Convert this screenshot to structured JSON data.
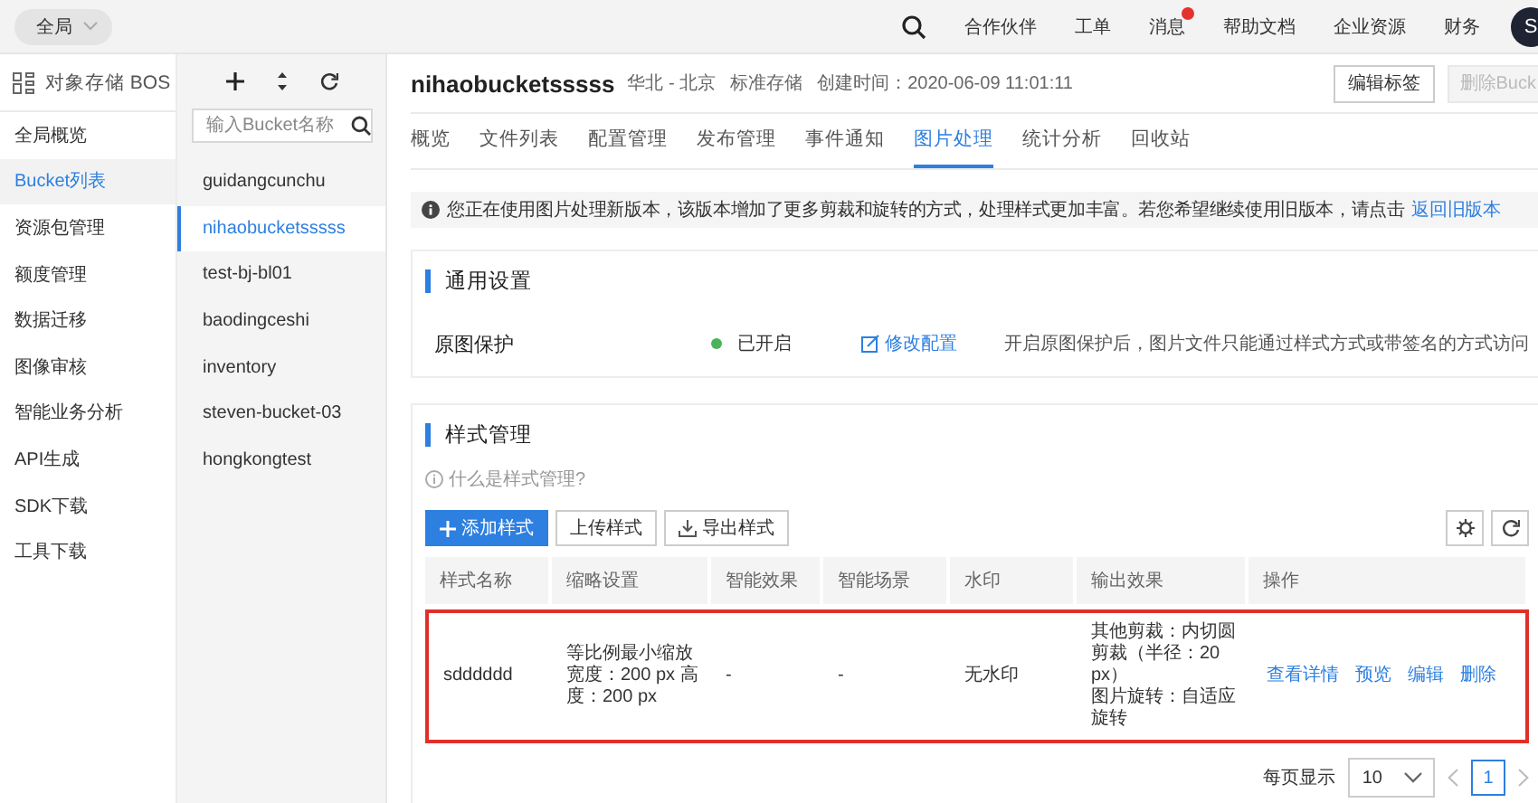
{
  "top_bar": {
    "scope": "全局",
    "links": [
      {
        "label": "合作伙伴",
        "dot": false
      },
      {
        "label": "工单",
        "dot": false
      },
      {
        "label": "消息",
        "dot": true
      },
      {
        "label": "帮助文档",
        "dot": false
      },
      {
        "label": "企业资源",
        "dot": false
      },
      {
        "label": "财务",
        "dot": false
      }
    ],
    "avatar": "S"
  },
  "sidebar": {
    "title": "对象存储 BOS",
    "items": [
      {
        "label": "全局概览",
        "selected": false
      },
      {
        "label": "Bucket列表",
        "selected": true
      },
      {
        "label": "资源包管理",
        "selected": false
      },
      {
        "label": "额度管理",
        "selected": false
      },
      {
        "label": "数据迁移",
        "selected": false
      },
      {
        "label": "图像审核",
        "selected": false
      },
      {
        "label": "智能业务分析",
        "selected": false
      },
      {
        "label": "API生成",
        "selected": false
      },
      {
        "label": "SDK下载",
        "selected": false
      },
      {
        "label": "工具下载",
        "selected": false
      }
    ]
  },
  "bucket_list": {
    "search": {
      "placeholder": "输入Bucket名称"
    },
    "items": [
      {
        "label": "guidangcunchu",
        "selected": false
      },
      {
        "label": "nihaobucketsssss",
        "selected": true
      },
      {
        "label": "test-bj-bl01",
        "selected": false
      },
      {
        "label": "baodingceshi",
        "selected": false
      },
      {
        "label": "inventory",
        "selected": false
      },
      {
        "label": "steven-bucket-03",
        "selected": false
      },
      {
        "label": "hongkongtest",
        "selected": false
      }
    ]
  },
  "header": {
    "title": "nihaobucketsssss",
    "region": "华北 - 北京",
    "storage_class": "标准存储",
    "created": "创建时间：2020-06-09 11:01:11",
    "buttons": [
      {
        "label": "编辑标签",
        "disabled": false
      },
      {
        "label": "删除Buck",
        "disabled": true
      }
    ]
  },
  "tabs": [
    {
      "label": "概览",
      "selected": false
    },
    {
      "label": "文件列表",
      "selected": false
    },
    {
      "label": "配置管理",
      "selected": false
    },
    {
      "label": "发布管理",
      "selected": false
    },
    {
      "label": "事件通知",
      "selected": false
    },
    {
      "label": "图片处理",
      "selected": true
    },
    {
      "label": "统计分析",
      "selected": false
    },
    {
      "label": "回收站",
      "selected": false
    }
  ],
  "notice": {
    "text": "您正在使用图片处理新版本，该版本增加了更多剪裁和旋转的方式，处理样式更加丰富。若您希望继续使用旧版本，请点击",
    "link": "返回旧版本"
  },
  "general_settings": {
    "title": "通用设置",
    "rows": [
      {
        "label": "原图保护",
        "on": true,
        "status": "已开启",
        "action": "修改配置",
        "description": "开启原图保护后，图片文件只能通过样式方式或带签名的方式访问"
      }
    ]
  },
  "style_management": {
    "title": "样式管理",
    "help": "什么是样式管理?",
    "buttons": [
      {
        "label": "添加样式",
        "kind": "primary"
      },
      {
        "label": "上传样式",
        "kind": "default"
      },
      {
        "label": "导出样式",
        "kind": "export"
      }
    ],
    "table": {
      "columns": [
        "样式名称",
        "缩略设置",
        "智能效果",
        "智能场景",
        "水印",
        "输出效果",
        "操作"
      ],
      "rows": [
        {
          "highlighted": true,
          "name": "sdddddd",
          "thumbnail": [
            "等比例最小缩放",
            "宽度：200 px 高度：200 px"
          ],
          "smart_effect": "-",
          "smart_scene": "-",
          "watermark": "无水印",
          "output": [
            "其他剪裁：内切圆剪裁（半径：20 px）",
            "图片旋转：自适应旋转"
          ],
          "actions": [
            "查看详情",
            "预览",
            "编辑",
            "删除"
          ]
        }
      ]
    },
    "pagination": {
      "label": "每页显示",
      "page_size": "10",
      "pages": [
        {
          "label": "1",
          "selected": true
        }
      ]
    }
  }
}
